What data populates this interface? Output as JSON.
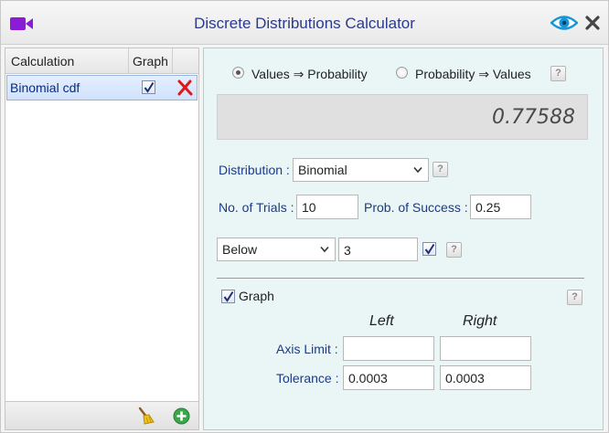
{
  "window": {
    "title": "Discrete Distributions Calculator",
    "icons": [
      "video-camera-icon",
      "eye-icon",
      "close-icon"
    ]
  },
  "left_panel": {
    "columns": {
      "calculation": "Calculation",
      "graph": "Graph"
    },
    "rows": [
      {
        "label": "Binomial cdf",
        "graph_checked": true,
        "selected": true
      }
    ],
    "footer_icons": [
      "broom-icon",
      "add-icon"
    ]
  },
  "mode": {
    "options": [
      "Values ⇒ Probability",
      "Probability ⇒ Values"
    ],
    "selected": "Values ⇒ Probability",
    "help": "?"
  },
  "result": "0.77588",
  "distribution": {
    "label": "Distribution :",
    "value": "Binomial",
    "help": "?"
  },
  "params": {
    "trials_label": "No. of Trials :",
    "trials_value": "10",
    "success_label": "Prob. of Success :",
    "success_value": "0.25"
  },
  "condition": {
    "direction": "Below",
    "value": "3",
    "checked": true,
    "help": "?"
  },
  "graph_section": {
    "label": "Graph",
    "checked": true,
    "help": "?",
    "left_header": "Left",
    "right_header": "Right",
    "axis_limit_label": "Axis Limit :",
    "axis_limit_left": "",
    "axis_limit_right": "",
    "tolerance_label": "Tolerance :",
    "tolerance_left": "0.0003",
    "tolerance_right": "0.0003"
  },
  "colors": {
    "title": "#2b3a8c",
    "accent_purple": "#8a1bd6",
    "label_blue": "#1c3a86",
    "panel_bg": "#eaf6f6",
    "delete_red": "#e01818",
    "add_green": "#3aa84a"
  }
}
